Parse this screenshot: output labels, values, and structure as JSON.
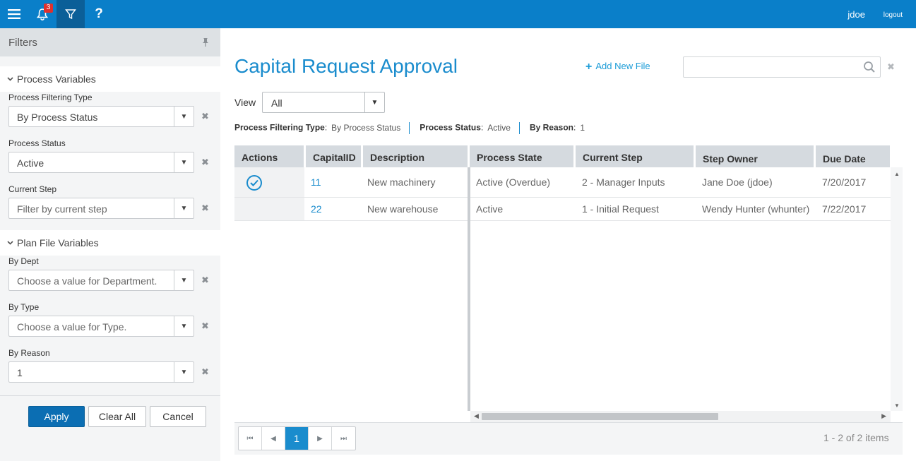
{
  "topbar": {
    "notification_count": "3",
    "help_label": "?",
    "user": "jdoe",
    "logout": "logout"
  },
  "sidebar": {
    "title": "Filters",
    "process_section": "Process Variables",
    "plan_section": "Plan File Variables",
    "fields": {
      "filtering_type": {
        "label": "Process Filtering Type",
        "value": "By Process Status"
      },
      "process_status": {
        "label": "Process Status",
        "value": "Active"
      },
      "current_step": {
        "label": "Current Step",
        "placeholder": "Filter by current step"
      },
      "by_dept": {
        "label": "By Dept",
        "placeholder": "Choose a value for Department."
      },
      "by_type": {
        "label": "By Type",
        "placeholder": "Choose a value for Type."
      },
      "by_reason": {
        "label": "By Reason",
        "value": "1"
      }
    },
    "buttons": {
      "apply": "Apply",
      "clear": "Clear All",
      "cancel": "Cancel"
    }
  },
  "main": {
    "title": "Capital Request Approval",
    "add_new_file": "Add New File",
    "view_label": "View",
    "view_value": "All",
    "active_filters": [
      {
        "label": "Process Filtering Type",
        "value": "By Process Status"
      },
      {
        "label": "Process Status",
        "value": "Active"
      },
      {
        "label": "By Reason",
        "value": "1"
      }
    ]
  },
  "grid": {
    "columns": [
      "Actions",
      "CapitalID",
      "Description",
      "Process State",
      "Current Step",
      "Step Owner",
      "Due Date"
    ],
    "rows": [
      {
        "id": "11",
        "description": "New machinery",
        "state": "Active (Overdue)",
        "step": "2 - Manager Inputs",
        "owner": "Jane Doe (jdoe)",
        "due": "7/20/2017"
      },
      {
        "id": "22",
        "description": "New warehouse",
        "state": "Active",
        "step": "1 - Initial Request",
        "owner": "Wendy Hunter (whunter)",
        "due": "7/22/2017"
      }
    ]
  },
  "pager": {
    "current_page": "1",
    "summary": "1 - 2 of 2 items"
  },
  "colors": {
    "topbar": "#0a7fc9",
    "accent": "#1a8ccd",
    "primary_button": "#0b6eb3"
  }
}
